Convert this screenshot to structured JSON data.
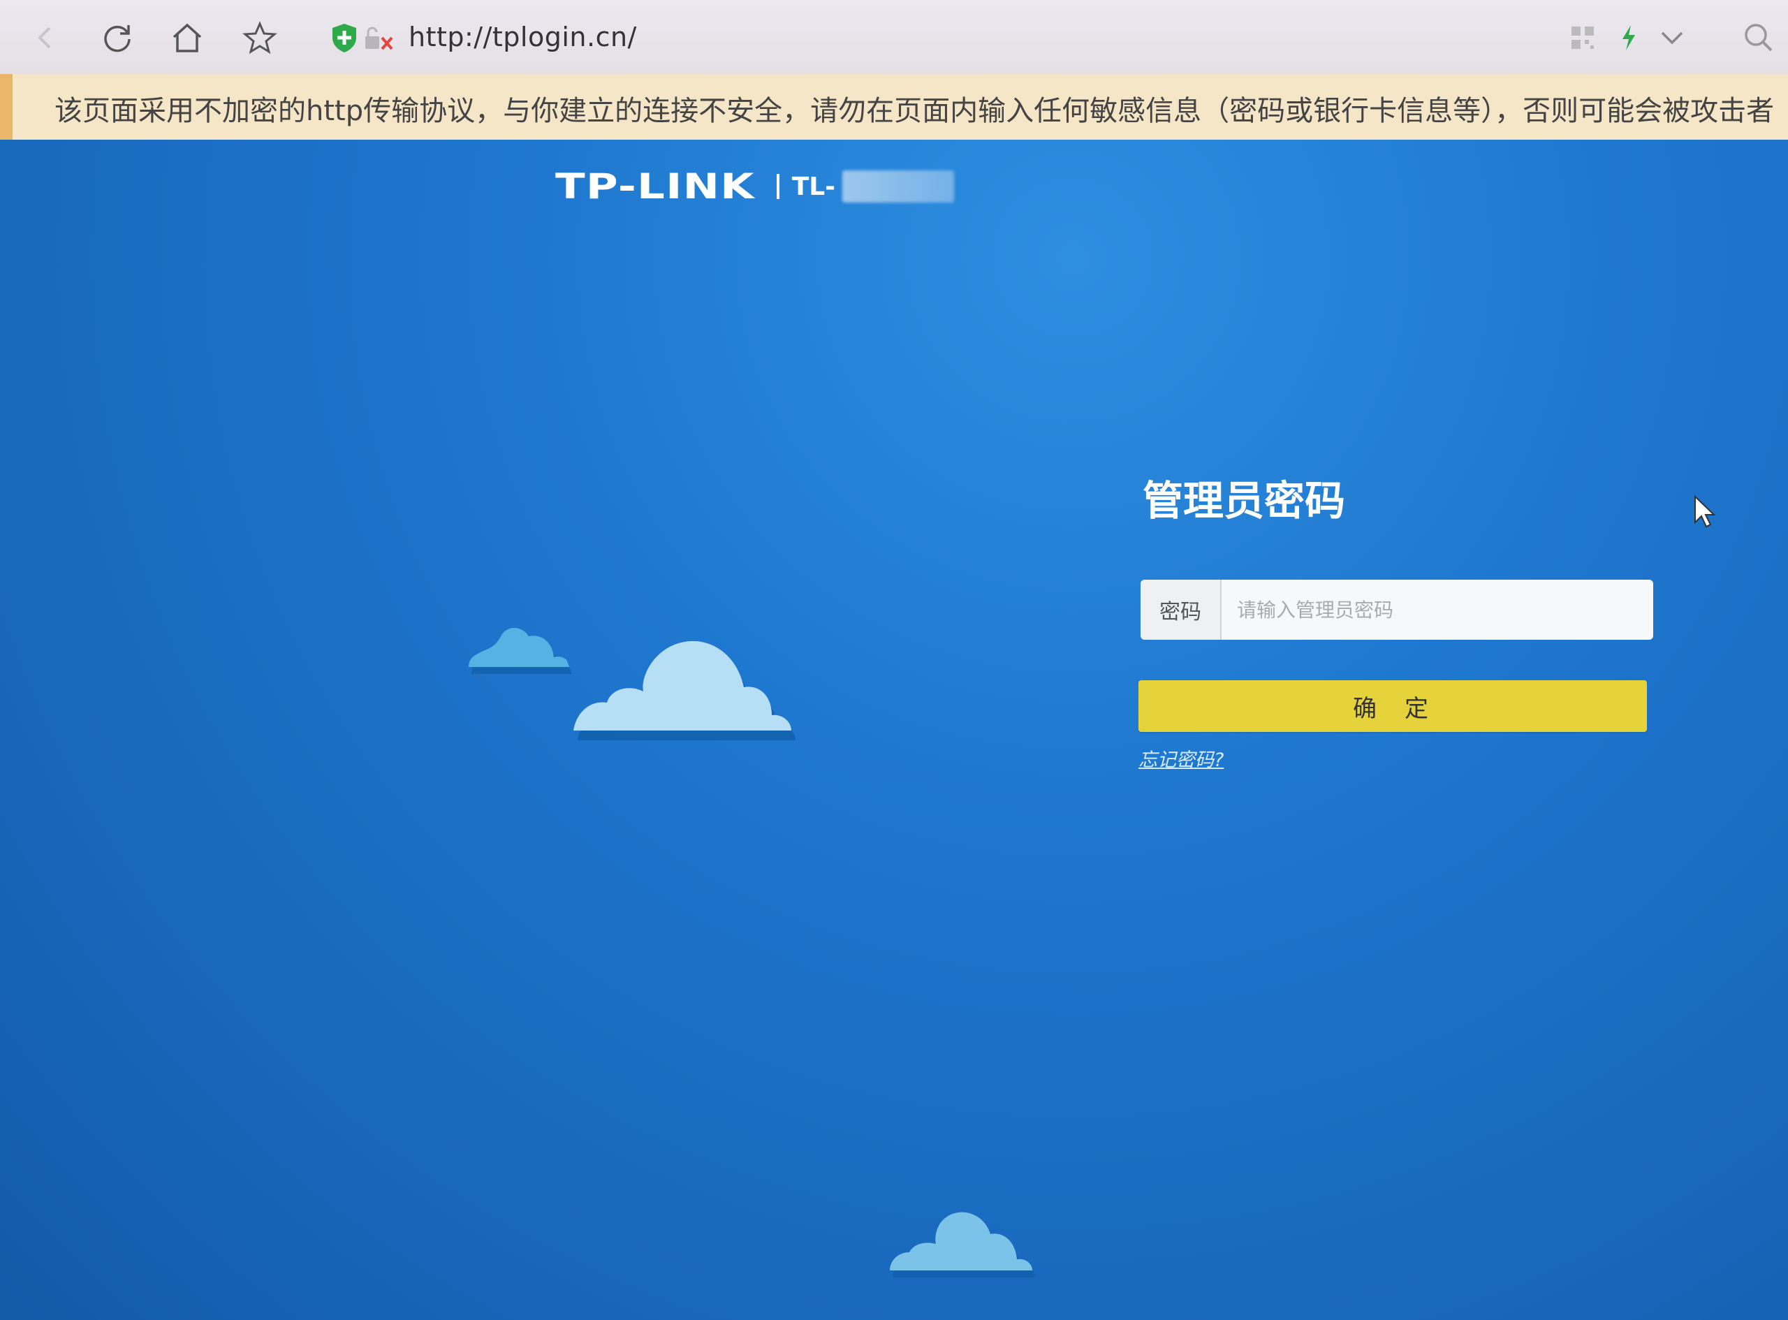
{
  "browser": {
    "url": "http://tplogin.cn/",
    "icons": [
      "back-icon",
      "refresh-icon",
      "home-icon",
      "star-icon",
      "shield-icon",
      "insecure-lock-icon",
      "qr-icon",
      "lightning-icon",
      "chevron-down-icon",
      "search-icon"
    ]
  },
  "warning": {
    "text": "该页面采用不加密的http传输协议，与你建立的连接不安全，请勿在页面内输入任何敏感信息（密码或银行卡信息等），否则可能会被攻击者"
  },
  "brand": {
    "name": "TP-LINK",
    "model_prefix": "TL-"
  },
  "login": {
    "title": "管理员密码",
    "password_label": "密码",
    "password_placeholder": "请输入管理员密码",
    "password_value": "",
    "confirm_label": "确定",
    "forgot_link": "忘记密码?"
  },
  "colors": {
    "background": "#1b6fc4",
    "button": "#e6d33c",
    "warning_bg": "#f6e6c8"
  }
}
